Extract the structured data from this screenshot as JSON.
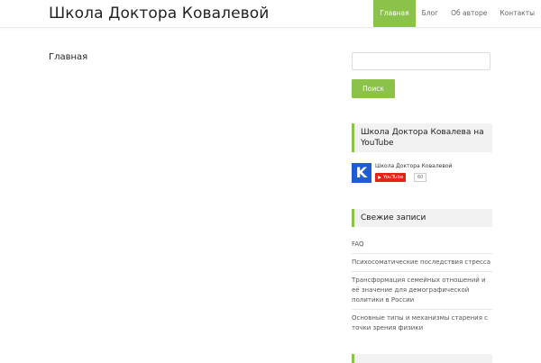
{
  "site": {
    "title": "Школа Доктора Ковалевой"
  },
  "nav": {
    "items": [
      {
        "label": "Главная",
        "active": true
      },
      {
        "label": "Блог",
        "active": false
      },
      {
        "label": "Об авторе",
        "active": false
      },
      {
        "label": "Контакты",
        "active": false
      }
    ]
  },
  "main": {
    "page_title": "Главная"
  },
  "search": {
    "value": "",
    "button_label": "Поиск"
  },
  "youtube_widget": {
    "title": "Школа Доктора Ковалева на YouTube",
    "logo_letter": "K",
    "channel_name": "Школа Доктора Ковалевой",
    "subscribe_label": "YouTube",
    "subscriber_count": "60"
  },
  "recent_posts": {
    "title": "Свежие записи",
    "items": [
      "FAQ",
      "Психосоматические последствия стресса",
      "Трансформация семейных отношений и её значение для демографической политики в России",
      "Основные типы и механизмы старения с точки зрения физики"
    ]
  },
  "colors": {
    "accent": "#8bc34a",
    "youtube_red": "#e62117",
    "logo_blue": "#1e5bd7"
  }
}
